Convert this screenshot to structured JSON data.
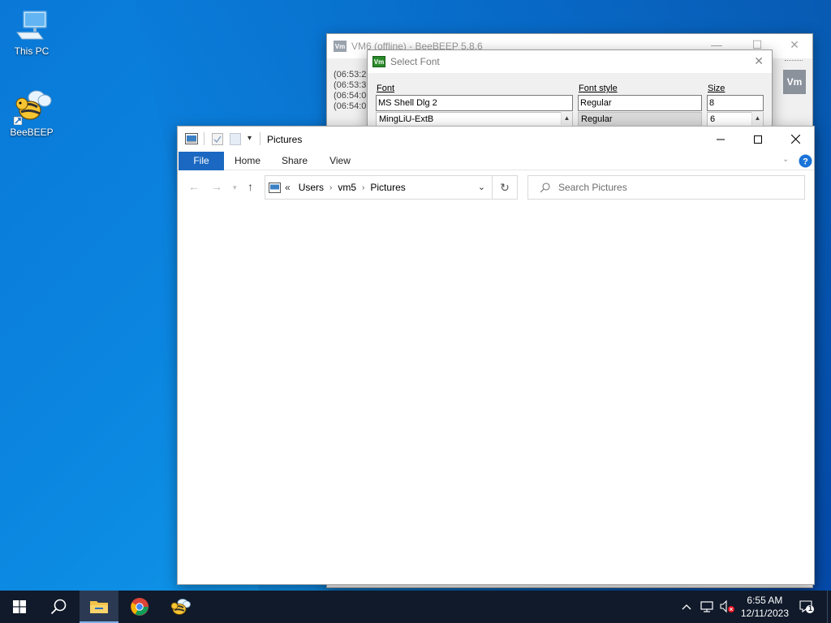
{
  "desktop": {
    "icons": [
      {
        "label": "This PC"
      },
      {
        "label": "BeeBEEP"
      }
    ]
  },
  "beebeep_window": {
    "title": "VM6 (offline) - BeeBEEP 5.8.6",
    "app_badge": "Vm",
    "log_lines": [
      "(06:53:2",
      "(06:53:3",
      "(06:54:0",
      "(06:54:0"
    ],
    "side_badge": "Vm"
  },
  "font_dialog": {
    "title": "Select Font",
    "app_badge": "Vm",
    "font_label": "Font",
    "font_style_label": "Font style",
    "size_label": "Size",
    "font_value": "MS Shell Dlg 2",
    "font_style_value": "Regular",
    "size_value": "8",
    "font_list_first": "MingLiU-ExtB",
    "style_list_first": "Regular",
    "size_list_first": "6"
  },
  "explorer": {
    "title": "Pictures",
    "tabs": [
      "File",
      "Home",
      "Share",
      "View"
    ],
    "breadcrumb": {
      "overflow": "«",
      "items": [
        "Users",
        "vm5",
        "Pictures"
      ]
    },
    "search_placeholder": "Search Pictures"
  },
  "taskbar": {
    "clock_time": "6:55 AM",
    "clock_date": "12/11/2023",
    "notification_count": "1"
  },
  "colors": {
    "accent": "#1a68c1",
    "taskbar": "#101a2a",
    "help_icon": "#1a73d9"
  }
}
